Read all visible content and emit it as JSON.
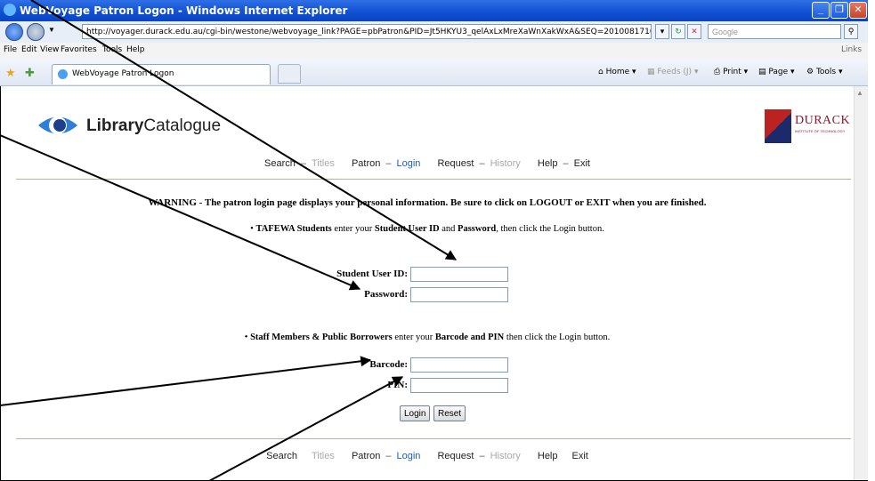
{
  "window": {
    "title": "WebVoyage Patron Logon - Windows Internet Explorer",
    "minimize": "_",
    "maximize": "❐",
    "close": "✕"
  },
  "address_bar": {
    "url": "http://voyager.durack.edu.au/cgi-bin/westone/webvoyage_link?PAGE=pbPatron&PID=Jt5HKYU3_qelAxLxMreXaWnXakWxA&SEQ=20100817104708",
    "search_placeholder": "Google"
  },
  "menu": {
    "items": [
      "File",
      "Edit",
      "View",
      "Favorites",
      "Tools",
      "Help"
    ],
    "links": "Links"
  },
  "tabs": {
    "active_tab_title": "WebVoyage Patron Logon"
  },
  "command_bar": {
    "home": "Home",
    "feeds": "Feeds (J)",
    "print": "Print",
    "page": "Page",
    "tools": "Tools"
  },
  "header": {
    "logo_bold": "Library",
    "logo_rest": "Catalogue",
    "institution_name": "DURACK",
    "institution_sub": "INSTITUTE OF TECHNOLOGY"
  },
  "nav_top": {
    "search": "Search",
    "titles": "Titles",
    "patron": "Patron",
    "login": "Login",
    "request": "Request",
    "history": "History",
    "help": "Help",
    "exit": "Exit",
    "sep": "–"
  },
  "warning": "WARNING - The patron login page displays your personal information. Be sure to click on LOGOUT or EXIT when you are finished.",
  "tafewa": {
    "bold1": "TAFEWA Students",
    "text1": " enter your ",
    "bold2": "Student User ID",
    "text2": " and ",
    "bold3": "Password",
    "text3": ", then click the Login button."
  },
  "staff": {
    "bold1": "Staff Members & Public Borrowers",
    "text1": " enter your ",
    "bold2": "Barcode and PIN",
    "text2": " then click the Login button."
  },
  "form": {
    "student_id_label": "Student User ID:",
    "password_label": "Password:",
    "barcode_label": "Barcode:",
    "pin_label": "PIN:",
    "student_id_value": "",
    "password_value": "",
    "barcode_value": "",
    "pin_value": "",
    "login_button": "Login",
    "reset_button": "Reset"
  },
  "nav_bottom": {
    "search": "Search",
    "titles": "Titles",
    "patron": "Patron",
    "login": "Login",
    "request": "Request",
    "history": "History",
    "help": "Help",
    "exit": "Exit",
    "sep": "–"
  },
  "colors": {
    "link_active": "#1c5fb8",
    "dimmed": "#aaaaaa",
    "titlebar": "#0f4fd1"
  }
}
